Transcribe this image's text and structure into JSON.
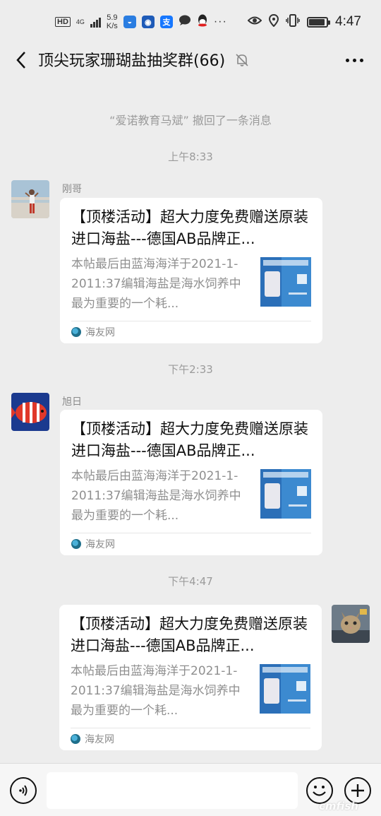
{
  "status_bar": {
    "hd": "HD",
    "network": "4G",
    "speed_value": "5.9",
    "speed_unit": "K/s",
    "alipay": "支",
    "more": "···",
    "time": "4:47",
    "battery_level": 0.9
  },
  "header": {
    "title": "顶尖玩家珊瑚盐抽奖群(66)"
  },
  "messages": {
    "recall_notice": "“爱诺教育马斌” 撤回了一条消息",
    "time_1": "上午8:33",
    "time_2": "下午2:33",
    "time_3": "下午4:47",
    "sender_1": "刚哥",
    "sender_2": "旭日",
    "card_title": "【顶楼活动】超大力度免费赠送原装进口海盐---德国AB品牌正...",
    "card_desc": "本帖最后由蓝海海洋于2021-1-2011:37编辑海盐是海水饲养中最为重要的一个耗...",
    "card_source": "海友网"
  },
  "watermark": "cmfish"
}
